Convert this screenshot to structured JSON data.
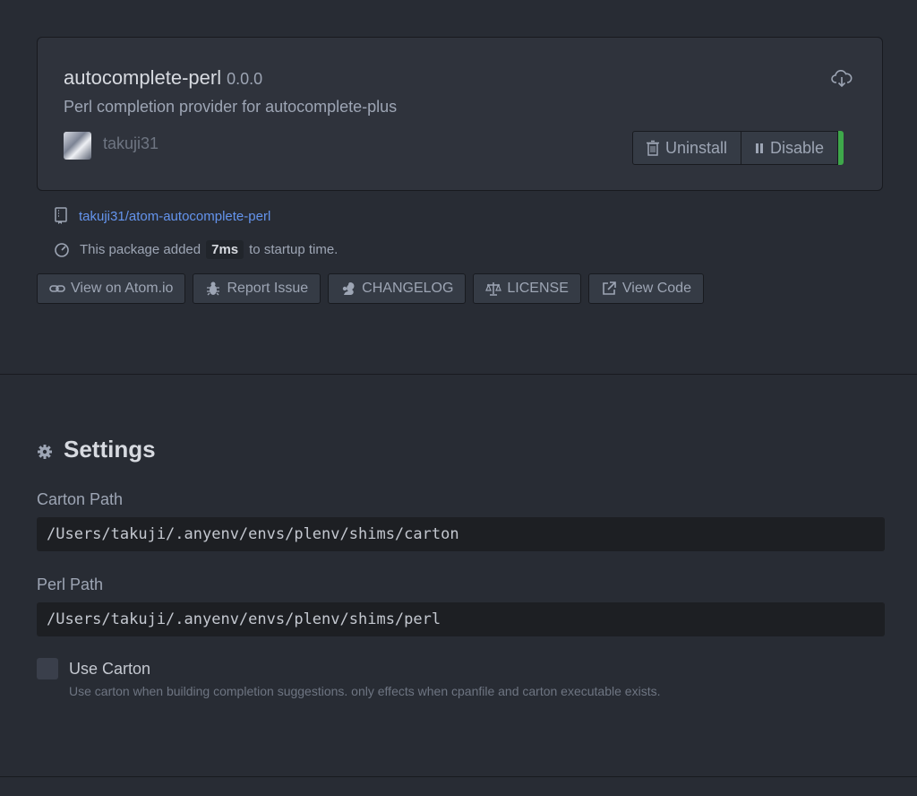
{
  "package": {
    "name": "autocomplete-perl",
    "version": "0.0.0",
    "description": "Perl completion provider for autocomplete-plus",
    "author": "takuji31",
    "icons": {
      "download": "cloud-download-icon",
      "avatar": "author-avatar"
    },
    "actions": {
      "uninstall_label": "Uninstall",
      "disable_label": "Disable"
    },
    "status_color": "#3ea84a"
  },
  "meta": {
    "repo": "takuji31/atom-autocomplete-perl",
    "startup_prefix": "This package added",
    "startup_time": "7ms",
    "startup_suffix": "to startup time."
  },
  "links": [
    {
      "label": "View on Atom.io",
      "icon": "link-icon"
    },
    {
      "label": "Report Issue",
      "icon": "bug-icon"
    },
    {
      "label": "CHANGELOG",
      "icon": "squirrel-icon"
    },
    {
      "label": "LICENSE",
      "icon": "law-icon"
    },
    {
      "label": "View Code",
      "icon": "external-link-icon"
    }
  ],
  "settings": {
    "title": "Settings",
    "carton_path": {
      "label": "Carton Path",
      "value": "/Users/takuji/.anyenv/envs/plenv/shims/carton"
    },
    "perl_path": {
      "label": "Perl Path",
      "value": "/Users/takuji/.anyenv/envs/plenv/shims/perl"
    },
    "use_carton": {
      "label": "Use Carton",
      "description": "Use carton when building completion suggestions. only effects when cpanfile and carton executable exists.",
      "checked": false
    }
  },
  "theme": {
    "background": "#282c34",
    "panel": "#2f333c",
    "link": "#6494ed"
  }
}
